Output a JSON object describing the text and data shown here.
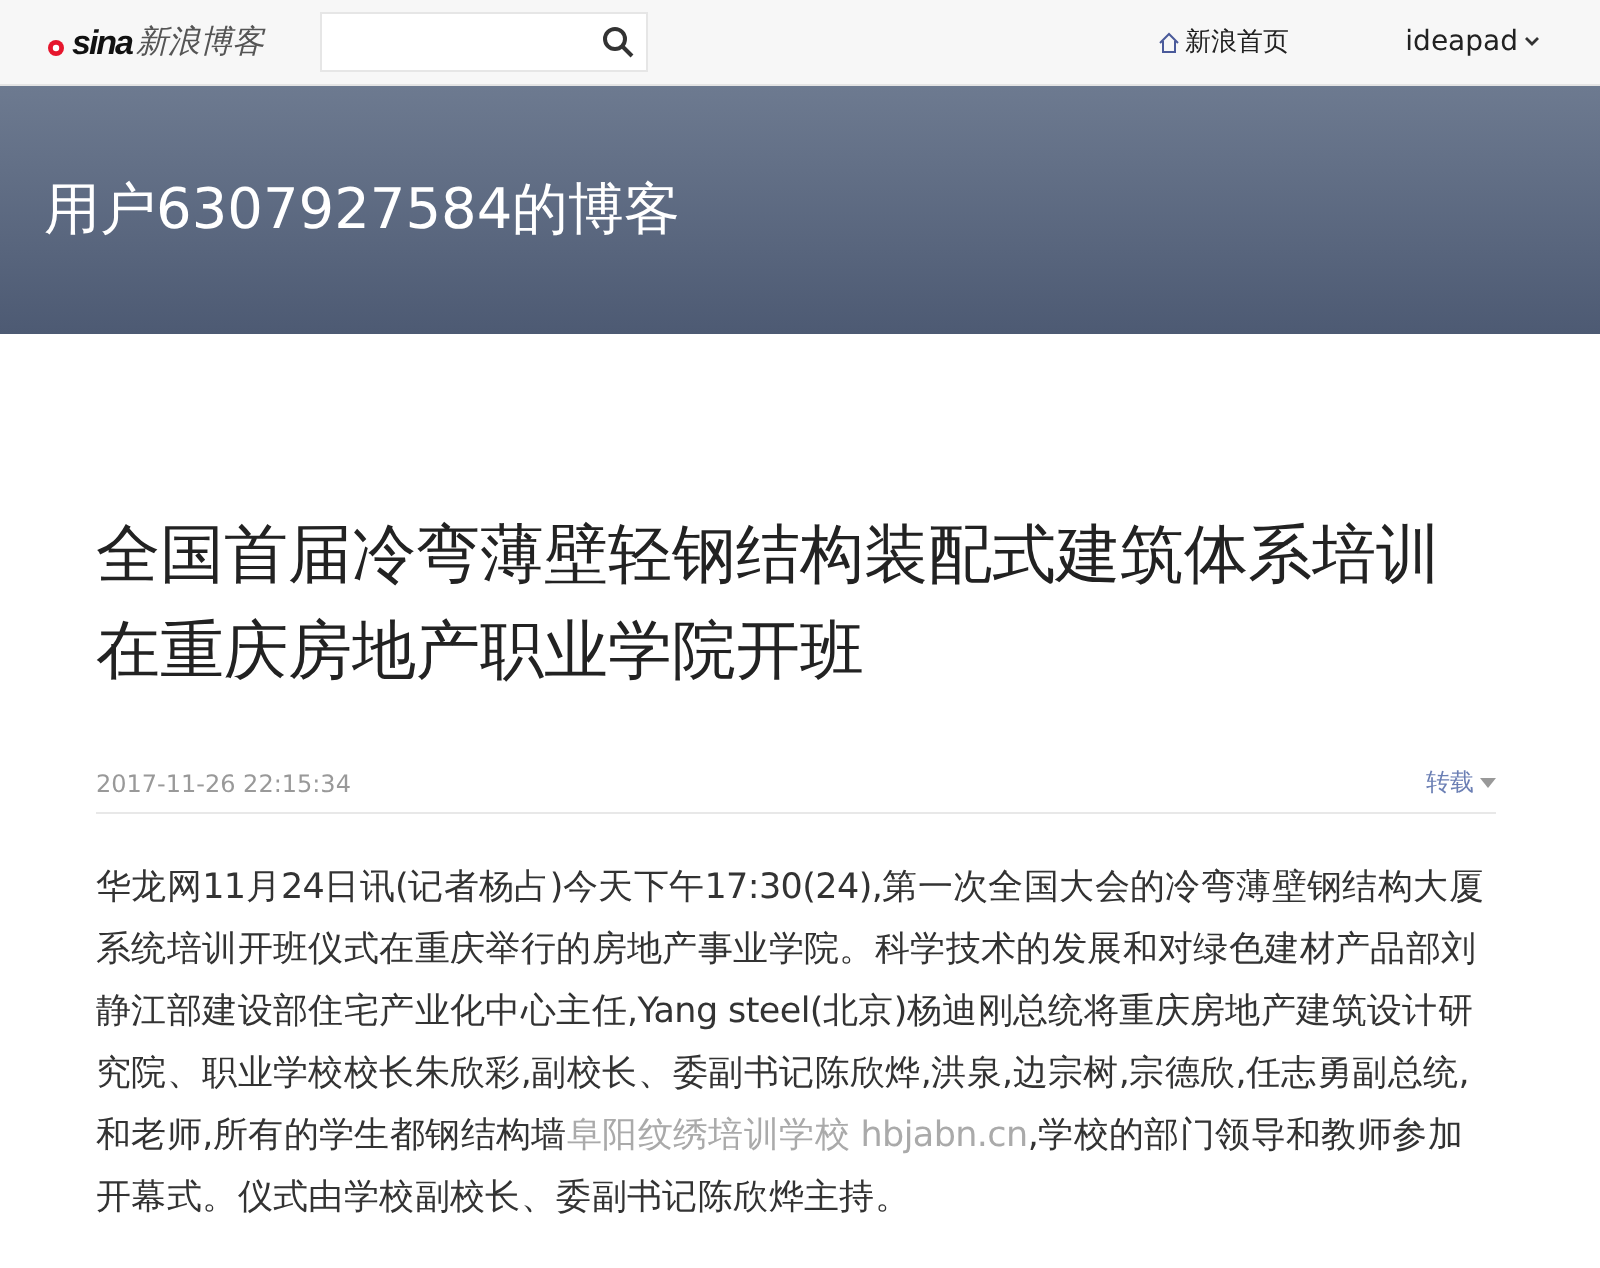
{
  "topbar": {
    "logo_mark": "sina",
    "logo_text": "新浪博客",
    "home_link": "新浪首页",
    "user_menu": "ideapad"
  },
  "banner": {
    "title": "用户6307927584的博客"
  },
  "article": {
    "title": "全国首届冷弯薄壁轻钢结构装配式建筑体系培训在重庆房地产职业学院开班",
    "date": "2017-11-26 22:15:34",
    "repost": "转载",
    "body": [
      {
        "kind": "text",
        "text": "华龙网11月24日讯(记者杨占)今天下午17:30(24),第一次全国大会的冷弯薄壁钢结构大厦系统培训开班仪式在重庆举行的房地产事业学院。科学技术的发展和对绿色建材产品部刘静江部建设部住宅产业化中心主任,Yang steel(北京)杨迪刚总统将重庆房地产建筑设计研究院、职业学校校长朱欣彩,副校长、委副书记陈欣烨,洪泉,边宗树,宗德欣,任志勇副总统,和老师,所有的学生都钢结构墙"
      },
      {
        "kind": "link",
        "text": "阜阳纹绣培训学校 hbjabn.cn"
      },
      {
        "kind": "text",
        "text": ",学校的部门领导和教师参加开幕式。仪式由学校副校长、委副书记陈欣烨主持。"
      }
    ]
  }
}
